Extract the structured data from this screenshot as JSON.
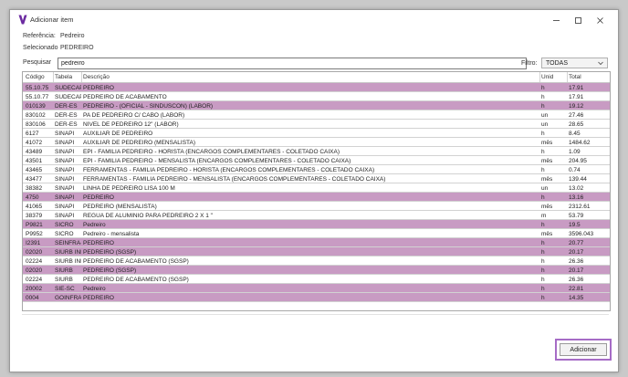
{
  "window": {
    "title": "Adicionar item",
    "brand_color": "#6b2aa0"
  },
  "info": {
    "referencia_label": "Referência:",
    "referencia_value": "Pedreiro",
    "selecionado_label": "Selecionado",
    "selecionado_value": "PEDREIRO"
  },
  "search": {
    "label": "Pesquisar",
    "value": "pedreiro"
  },
  "filter": {
    "label": "Filtro:",
    "value": "TODAS"
  },
  "table": {
    "columns": [
      "Código",
      "Tabela",
      "Descrição",
      "Unid",
      "Total"
    ],
    "highlight_color": "#c89bc3",
    "rows": [
      {
        "codigo": "55.10.75",
        "tabela": "SUDECAP",
        "descricao": "PEDREIRO",
        "unid": "h",
        "total": "17.91",
        "highlight": true
      },
      {
        "codigo": "55.10.77",
        "tabela": "SUDECAP",
        "descricao": "PEDREIRO DE ACABAMENTO",
        "unid": "h",
        "total": "17.91",
        "highlight": false
      },
      {
        "codigo": "010139",
        "tabela": "DER-ES",
        "descricao": "PEDREIRO - (OFICIAL - SINDUSCON) (LABOR)",
        "unid": "h",
        "total": "19.12",
        "highlight": true
      },
      {
        "codigo": "830102",
        "tabela": "DER-ES",
        "descricao": "PA DE PEDREIRO C/ CABO (LABOR)",
        "unid": "un",
        "total": "27.46",
        "highlight": false
      },
      {
        "codigo": "830106",
        "tabela": "DER-ES",
        "descricao": "NIVEL DE PEDREIRO 12\" (LABOR)",
        "unid": "un",
        "total": "28.65",
        "highlight": false
      },
      {
        "codigo": "6127",
        "tabela": "SINAPI",
        "descricao": "AUXILIAR DE PEDREIRO",
        "unid": "h",
        "total": "8.45",
        "highlight": false
      },
      {
        "codigo": "41072",
        "tabela": "SINAPI",
        "descricao": "AUXILIAR DE PEDREIRO (MENSALISTA)",
        "unid": "mês",
        "total": "1484.62",
        "highlight": false
      },
      {
        "codigo": "43489",
        "tabela": "SINAPI",
        "descricao": "EPI - FAMILIA PEDREIRO - HORISTA (ENCARGOS COMPLEMENTARES - COLETADO CAIXA)",
        "unid": "h",
        "total": "1.09",
        "highlight": false
      },
      {
        "codigo": "43501",
        "tabela": "SINAPI",
        "descricao": "EPI - FAMILIA PEDREIRO - MENSALISTA (ENCARGOS COMPLEMENTARES - COLETADO CAIXA)",
        "unid": "mês",
        "total": "204.95",
        "highlight": false
      },
      {
        "codigo": "43465",
        "tabela": "SINAPI",
        "descricao": "FERRAMENTAS - FAMILIA PEDREIRO - HORISTA (ENCARGOS COMPLEMENTARES - COLETADO CAIXA)",
        "unid": "h",
        "total": "0.74",
        "highlight": false
      },
      {
        "codigo": "43477",
        "tabela": "SINAPI",
        "descricao": "FERRAMENTAS - FAMILIA PEDREIRO - MENSALISTA (ENCARGOS COMPLEMENTARES - COLETADO CAIXA)",
        "unid": "mês",
        "total": "139.44",
        "highlight": false
      },
      {
        "codigo": "38382",
        "tabela": "SINAPI",
        "descricao": "LINHA DE PEDREIRO LISA 100 M",
        "unid": "un",
        "total": "13.02",
        "highlight": false
      },
      {
        "codigo": "4750",
        "tabela": "SINAPI",
        "descricao": "PEDREIRO",
        "unid": "h",
        "total": "13.16",
        "highlight": true
      },
      {
        "codigo": "41065",
        "tabela": "SINAPI",
        "descricao": "PEDREIRO (MENSALISTA)",
        "unid": "mês",
        "total": "2312.61",
        "highlight": false
      },
      {
        "codigo": "38379",
        "tabela": "SINAPI",
        "descricao": "REGUA DE ALUMINIO PARA PEDREIRO 2 X 1 \"",
        "unid": "m",
        "total": "53.79",
        "highlight": false
      },
      {
        "codigo": "P9821",
        "tabela": "SICRO",
        "descricao": "Pedreiro",
        "unid": "h",
        "total": "19.5",
        "highlight": true
      },
      {
        "codigo": "P9952",
        "tabela": "SICRO",
        "descricao": "Pedreiro - mensalista",
        "unid": "mês",
        "total": "3596.043",
        "highlight": false
      },
      {
        "codigo": "I2391",
        "tabela": "SEINFRA-C",
        "descricao": "PEDREIRO",
        "unid": "h",
        "total": "20.77",
        "highlight": true
      },
      {
        "codigo": "02020",
        "tabela": "SIURB INF",
        "descricao": "PEDREIRO (SGSP)",
        "unid": "h",
        "total": "20.17",
        "highlight": true
      },
      {
        "codigo": "02224",
        "tabela": "SIURB INF",
        "descricao": "PEDREIRO DE ACABAMENTO (SGSP)",
        "unid": "h",
        "total": "26.36",
        "highlight": false
      },
      {
        "codigo": "02020",
        "tabela": "SIURB",
        "descricao": "PEDREIRO (SGSP)",
        "unid": "h",
        "total": "20.17",
        "highlight": true
      },
      {
        "codigo": "02224",
        "tabela": "SIURB",
        "descricao": "PEDREIRO DE ACABAMENTO (SGSP)",
        "unid": "h",
        "total": "26.36",
        "highlight": false
      },
      {
        "codigo": "20002",
        "tabela": "SIE-SC",
        "descricao": "Pedreiro",
        "unid": "h",
        "total": "22.81",
        "highlight": true
      },
      {
        "codigo": "0004",
        "tabela": "GOINFRA",
        "descricao": "PEDREIRO",
        "unid": "h",
        "total": "14.35",
        "highlight": true
      }
    ]
  },
  "actions": {
    "add_label": "Adicionar",
    "add_outline_color": "#a66cc6"
  }
}
